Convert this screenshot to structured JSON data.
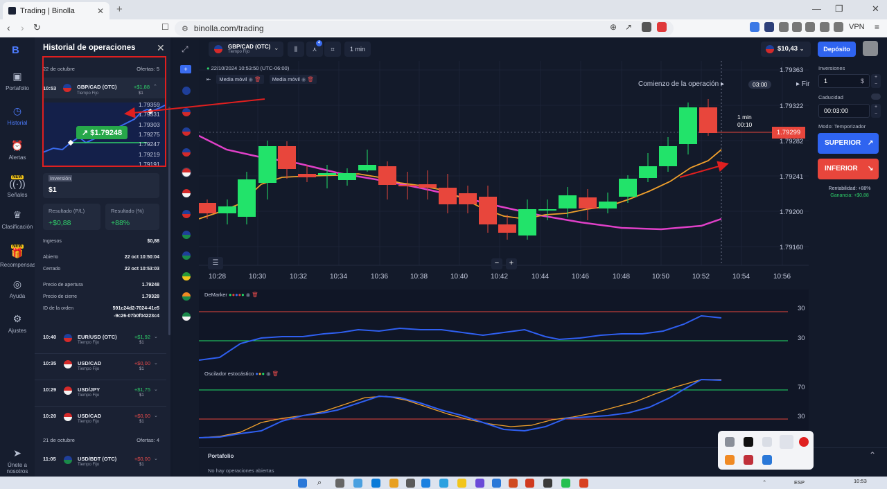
{
  "browser": {
    "tab_title": "Trading | Binolla",
    "url": "binolla.com/trading",
    "vpn_label": "VPN"
  },
  "nav": {
    "items": [
      {
        "label": "Portafolio",
        "icon": "briefcase-icon"
      },
      {
        "label": "Historial",
        "icon": "history-icon",
        "active": true
      },
      {
        "label": "Alertas",
        "icon": "alarm-icon"
      },
      {
        "label": "Señales",
        "icon": "signal-icon",
        "badge": "NEW"
      },
      {
        "label": "Clasificación",
        "icon": "trophy-icon"
      },
      {
        "label": "Recompensas",
        "icon": "gift-icon",
        "badge": "NEW"
      },
      {
        "label": "Ayuda",
        "icon": "help-icon"
      },
      {
        "label": "Ajustes",
        "icon": "gear-icon"
      },
      {
        "label": "Únete a nosotros",
        "icon": "telegram-icon"
      }
    ]
  },
  "history": {
    "title": "Historial de operaciones",
    "day1": {
      "date": "22 de octubre",
      "count_label": "Ofertas: 5"
    },
    "day2": {
      "date": "21 de octubre",
      "count_label": "Ofertas: 4"
    },
    "open_trade": {
      "time": "10:53",
      "pair": "GBP/CAD (OTC)",
      "type": "Tiempo Fijo",
      "gain": "+$1,88",
      "stake": "$1"
    },
    "mini_price_tag": "$1.79248",
    "mini_labels": [
      "1.79359",
      "1.79331",
      "1.79303",
      "1.79275",
      "1.79247",
      "1.79219",
      "1.79191"
    ],
    "investment_label": "Inversión",
    "investment_value": "$1",
    "result_pl_label": "Resultado (P/L)",
    "result_pl_value": "+$0,88",
    "result_pct_label": "Resultado (%)",
    "result_pct_value": "+88%",
    "details": [
      {
        "k": "Ingresos",
        "v": "$0,88"
      },
      {
        "k": "Abierto",
        "v": "22 oct 10:50:04"
      },
      {
        "k": "Cerrado",
        "v": "22 oct 10:53:03"
      },
      {
        "k": "Precio de apertura",
        "v": "1.79248"
      },
      {
        "k": "Precio de cierre",
        "v": "1.79328"
      },
      {
        "k": "ID de la orden",
        "v": "591c24d2-7024-41e5"
      }
    ],
    "order_id_line2": "-9c26-07b0f04223c4",
    "trades": [
      {
        "time": "10:40",
        "pair": "EUR/USD (OTC)",
        "type": "Tiempo Fijo",
        "gain": "+$1,92",
        "stake": "$1",
        "win": true
      },
      {
        "time": "10:35",
        "pair": "USD/CAD",
        "type": "Tiempo Fijo",
        "gain": "+$0,00",
        "stake": "$1",
        "win": false
      },
      {
        "time": "10:29",
        "pair": "USD/JPY",
        "type": "Tiempo Fijo",
        "gain": "+$1,75",
        "stake": "$1",
        "win": true
      },
      {
        "time": "10:20",
        "pair": "USD/CAD",
        "type": "Tiempo Fijo",
        "gain": "+$0,00",
        "stake": "$1",
        "win": false
      },
      {
        "time": "11:05",
        "pair": "USD/BDT (OTC)",
        "type": "Tiempo Fijo",
        "gain": "+$0,00",
        "stake": "$1",
        "win": false
      }
    ]
  },
  "toolbar": {
    "asset": "GBP/CAD (OTC)",
    "asset_type": "Tiempo Fijo",
    "indicators_count": "4",
    "timeframe": "1 min"
  },
  "header": {
    "balance": "$10,43",
    "deposit_label": "Depósito"
  },
  "chart": {
    "timestamp": "22/10/2024 10:53:50 (UTC-06:00)",
    "indicator_tags": [
      "Media móvil",
      "Media móvil"
    ],
    "start_label": "Comienzo de la operación",
    "start_timer": "03:00",
    "fin_label": "Fir",
    "countdown_label": "1 min",
    "countdown_value": "00:10",
    "current_price": "1.79299",
    "price_axis": [
      "1.79363",
      "1.79322",
      "1.79282",
      "1.79241",
      "1.79200",
      "1.79160"
    ],
    "time_axis": [
      "10:28",
      "10:30",
      "10:32",
      "10:34",
      "10:36",
      "10:38",
      "10:40",
      "10:42",
      "10:44",
      "10:46",
      "10:48",
      "10:50",
      "10:52",
      "10:54",
      "10:56"
    ],
    "demarker_label": "DeMarker",
    "demarker_levels": [
      "30",
      "30"
    ],
    "stoch_label": "Oscilador estocástico",
    "stoch_levels": [
      "70",
      "30"
    ]
  },
  "right": {
    "inv_label": "Inversiones",
    "inv_value": "1",
    "inv_currency": "$",
    "exp_label": "Caducidad",
    "exp_value": "00:03:00",
    "mode_label": "Modo: Temporizador",
    "up_label": "SUPERIOR",
    "down_label": "INFERIOR",
    "profitability": "Rentabilidad: +88%",
    "gain": "Ganancia: +$0,88"
  },
  "portfolio": {
    "title": "Portafolio",
    "empty": "No hay operaciones abiertas"
  },
  "taskbar": {
    "lang": "ESP",
    "time": "10:53"
  },
  "colors": {
    "up": "#22e36a",
    "down": "#e8463c",
    "accent": "#2f64f0",
    "ma_fast": "#f0a02c",
    "ma_slow": "#e040c8"
  }
}
